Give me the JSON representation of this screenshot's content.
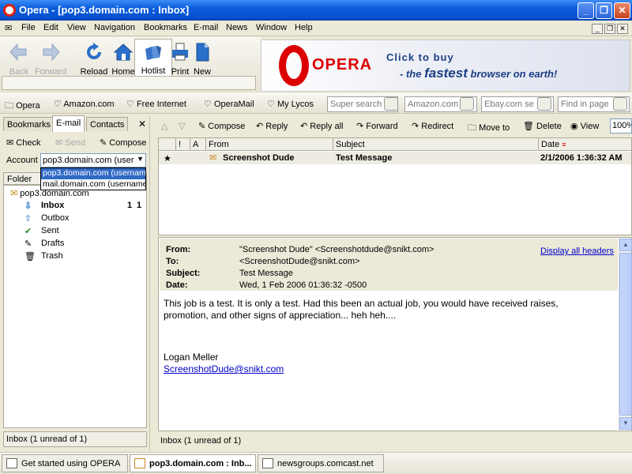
{
  "window": {
    "title": "Opera - [pop3.domain.com : Inbox]"
  },
  "menu": [
    "File",
    "Edit",
    "View",
    "Navigation",
    "Bookmarks",
    "E-mail",
    "News",
    "Window",
    "Help"
  ],
  "toolbar": [
    {
      "label": "Back",
      "icon": "back-arrow-icon",
      "enabled": false
    },
    {
      "label": "Forward",
      "icon": "forward-arrow-icon",
      "enabled": false
    },
    {
      "label": "Reload",
      "icon": "reload-icon",
      "enabled": true
    },
    {
      "label": "Home",
      "icon": "home-icon",
      "enabled": true
    },
    {
      "label": "Hotlist",
      "icon": "hotlist-icon",
      "enabled": true
    },
    {
      "label": "Print",
      "icon": "printer-icon",
      "enabled": true
    },
    {
      "label": "New",
      "icon": "new-page-icon",
      "enabled": true
    }
  ],
  "banner": {
    "logo": "OPERA",
    "line1": "Click to buy",
    "line2_pre": "- the",
    "line2_big": "fastest",
    "line2_post": "browser on earth!"
  },
  "personal_bar": [
    "Opera",
    "Amazon.com",
    "Free Internet",
    "OperaMail",
    "My Lycos"
  ],
  "search_fields": [
    "Super search",
    "Amazon.com",
    "Ebay.com se",
    "Find in page"
  ],
  "left_panel": {
    "tabs": [
      "Bookmarks",
      "E-mail",
      "Contacts"
    ],
    "close": "✕",
    "actions": [
      "Check",
      "Send",
      "Compose"
    ],
    "account_label": "Account",
    "account_value": "pop3.domain.com (user",
    "account_options": [
      "pop3.domain.com (usernam",
      "mail.domain.com (username"
    ],
    "folder_header": "Folder",
    "root": "pop3.domain.com",
    "folders": [
      {
        "name": "Inbox",
        "icon": "inbox-icon",
        "count1": "1",
        "count2": "1"
      },
      {
        "name": "Outbox",
        "icon": "outbox-icon"
      },
      {
        "name": "Sent",
        "icon": "sent-check-icon"
      },
      {
        "name": "Drafts",
        "icon": "drafts-icon"
      },
      {
        "name": "Trash",
        "icon": "trash-icon"
      }
    ],
    "status": "Inbox (1 unread of 1)"
  },
  "mail_toolbar": [
    "Compose",
    "Reply",
    "Reply all",
    "Forward",
    "Redirect",
    "Move to",
    "Delete",
    "View"
  ],
  "zoom": "100%",
  "list": {
    "columns": [
      "!",
      "A",
      "From",
      "Subject",
      "Date"
    ],
    "rows": [
      {
        "star": "★",
        "from": "Screenshot Dude",
        "subject": "Test Message",
        "date": "2/1/2006 1:36:32 AM"
      }
    ]
  },
  "message": {
    "headers": [
      {
        "key": "From:",
        "value": "\"Screenshot Dude\" <Screenshotdude@snikt.com>"
      },
      {
        "key": "To:",
        "value": "<ScreenshotDude@snikt.com>"
      },
      {
        "key": "Subject:",
        "value": "Test Message"
      },
      {
        "key": "Date:",
        "value": "Wed, 1 Feb 2006 01:36:32 -0500"
      }
    ],
    "display_all": "Display all headers",
    "body": [
      "This job is a test.  It is only a test.  Had this been an actual job, you would have received raises,",
      "promotion, and other signs of appreciation... heh heh...."
    ],
    "signature_name": "Logan Meller",
    "signature_email": "ScreenshotDude@snikt.com",
    "status": "Inbox (1 unread of 1)"
  },
  "pages": [
    {
      "label": "Get started using OPERA",
      "active": false
    },
    {
      "label": "pop3.domain.com : Inb...",
      "active": true
    },
    {
      "label": "newsgroups.comcast.net",
      "active": false
    }
  ],
  "colors": {
    "titlebar": "#0552d3",
    "link": "#0000cc",
    "selection": "#316ac5",
    "opera_red": "#dd0000"
  }
}
